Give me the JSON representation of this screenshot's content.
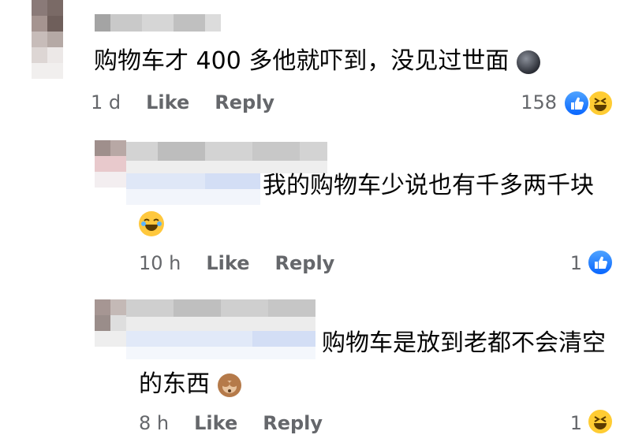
{
  "comments": [
    {
      "text": "购物车才 400 多他就吓到，没见过世面",
      "time": "1 d",
      "like_label": "Like",
      "reply_label": "Reply",
      "reaction_count": "158",
      "reactions": [
        "like-icon",
        "haha-icon"
      ]
    },
    {
      "text_line1": "我的购物车少说也有千多两千块",
      "time": "10 h",
      "like_label": "Like",
      "reply_label": "Reply",
      "reaction_count": "1",
      "reactions": [
        "like-icon"
      ]
    },
    {
      "text_line1": "购物车是放到老都不会清空",
      "text_line2": "的东西",
      "time": "8 h",
      "like_label": "Like",
      "reply_label": "Reply",
      "reaction_count": "1",
      "reactions": [
        "haha-icon"
      ]
    }
  ],
  "colors": {
    "meta": "#65676b",
    "like_blue": "#0866ff",
    "haha_yellow": "#ffcc33"
  }
}
